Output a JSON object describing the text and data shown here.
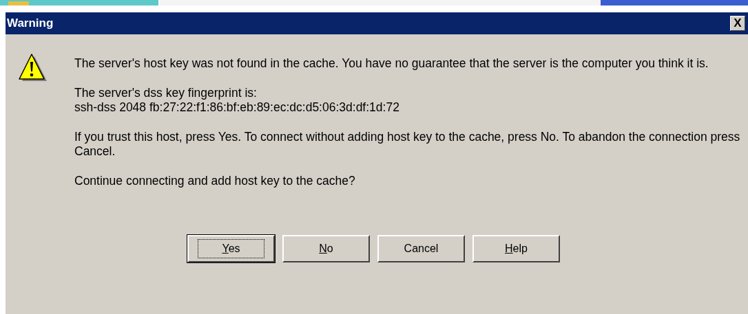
{
  "window": {
    "title": "Warning",
    "close": "X"
  },
  "message": {
    "paragraphs": [
      "The server's host key was not found in the cache. You have no guarantee that the server is the computer you think it is.",
      "The server's dss key fingerprint is:\nssh-dss 2048 fb:27:22:f1:86:bf:eb:89:ec:dc:d5:06:3d:df:1d:72",
      "If you trust this host, press Yes. To connect without adding host key to the cache, press No. To abandon the connection press Cancel.",
      "Continue connecting and add host key to the cache?"
    ]
  },
  "buttons": [
    {
      "label": "Yes",
      "mnemonic": true,
      "default": true
    },
    {
      "label": "No",
      "mnemonic": true,
      "default": false
    },
    {
      "label": "Cancel",
      "mnemonic": false,
      "default": false
    },
    {
      "label": "Help",
      "mnemonic": true,
      "default": false
    }
  ]
}
